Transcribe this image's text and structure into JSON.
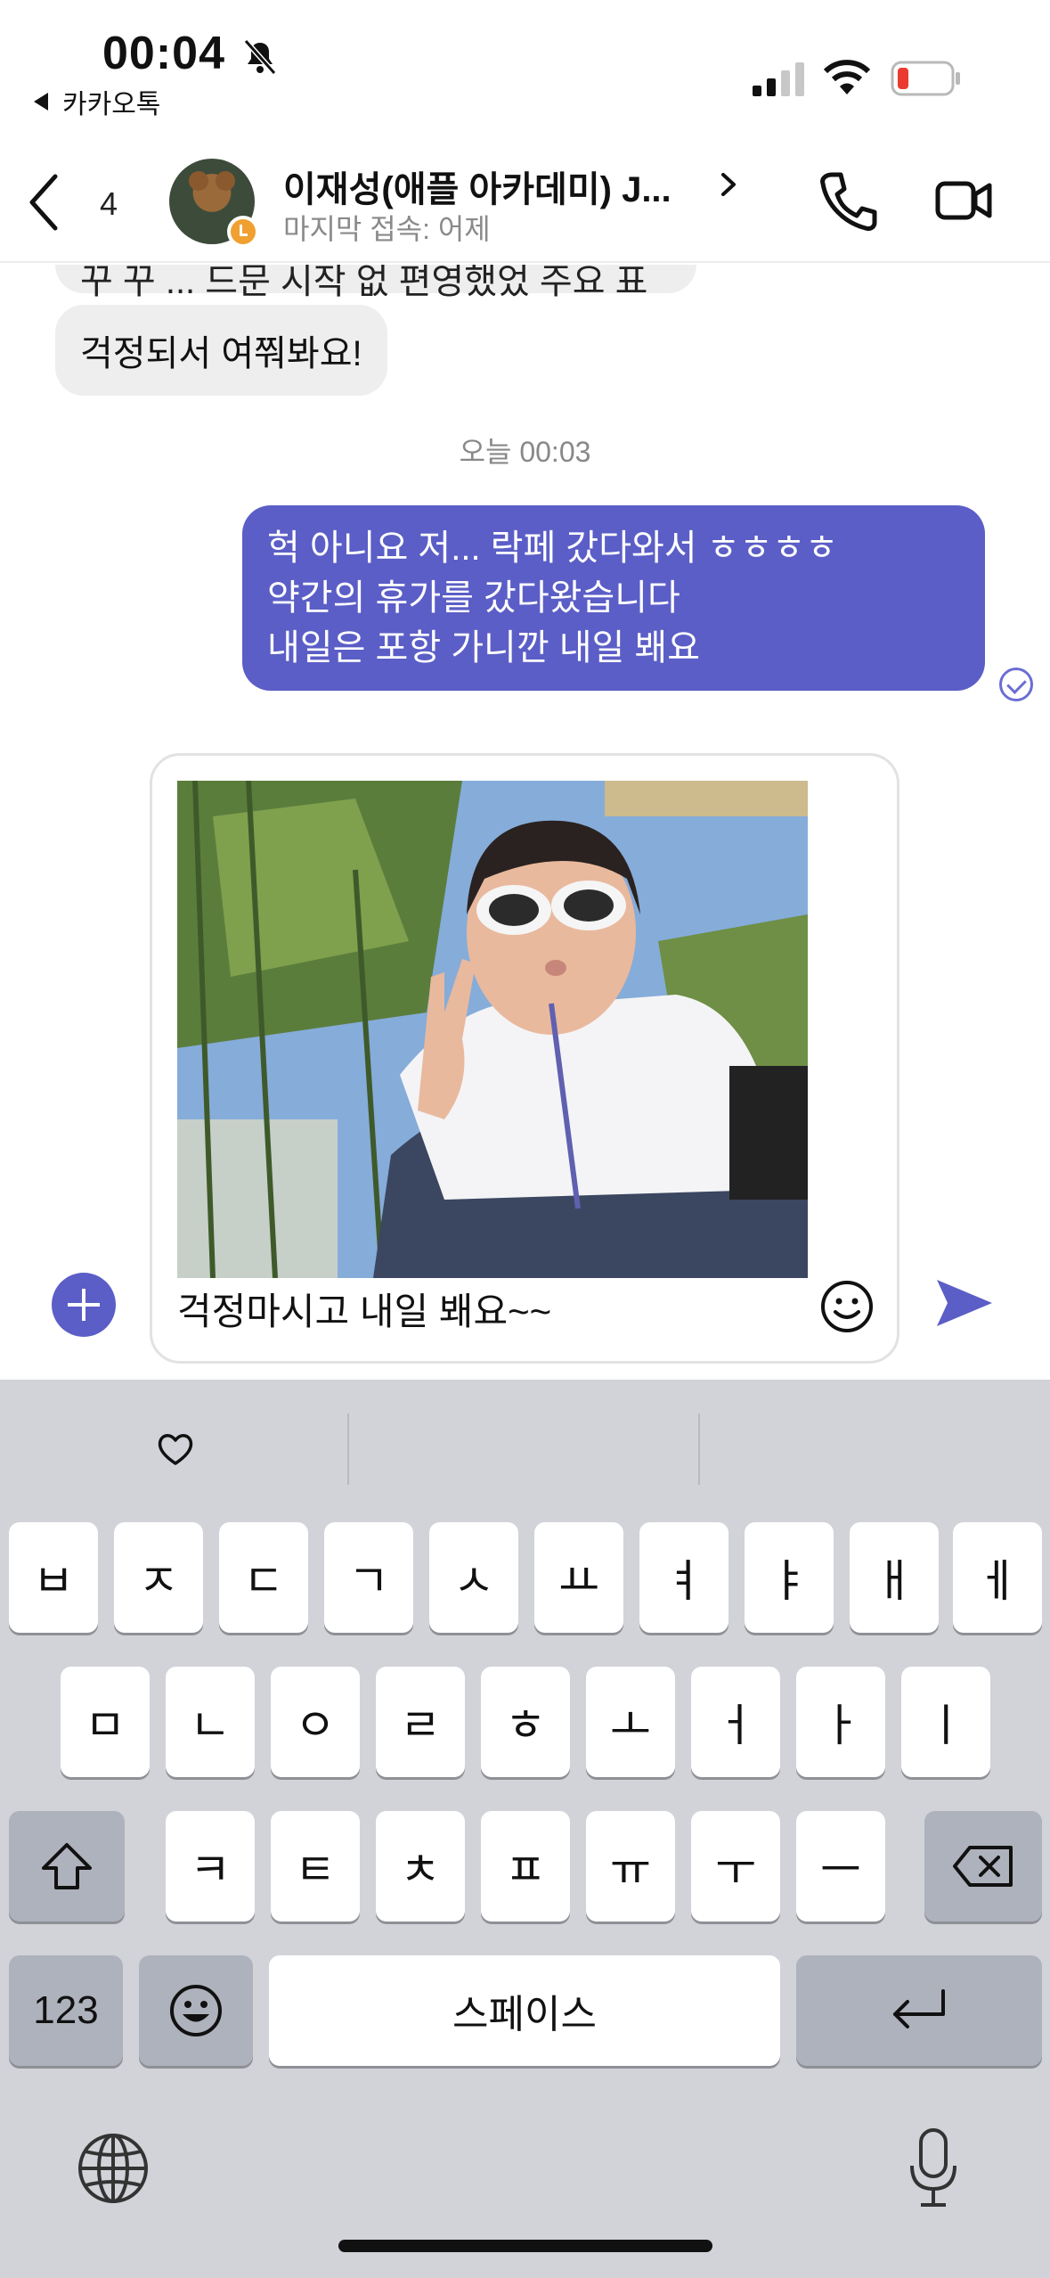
{
  "status_bar": {
    "time": "00:04",
    "back_app_label": "카카오톡"
  },
  "header": {
    "unread_count": "4",
    "name": "이재성(애플 아카데미) J...",
    "last_seen": "마지막 접속: 어제"
  },
  "messages": [
    {
      "direction": "in",
      "text": "꾸 꾸 ... 드문 시작 없 편영했었 주요 표"
    },
    {
      "direction": "in",
      "text": "걱정되서 여쭤봐요!"
    },
    {
      "type": "timestamp",
      "text": "오늘 00:03"
    },
    {
      "direction": "out",
      "lines": [
        "헉 아니요 저... 락페 갔다와서 ㅎㅎㅎㅎ",
        "약간의 휴가를 갔다왔습니다",
        "내일은 포항 가니깐 내일 봬요"
      ]
    }
  ],
  "composer": {
    "text": "걱정마시고 내일 봬요~~",
    "attachment": "photo"
  },
  "keyboard": {
    "row1": [
      "ㅂ",
      "ㅈ",
      "ㄷ",
      "ㄱ",
      "ㅅ",
      "ㅛ",
      "ㅕ",
      "ㅑ",
      "ㅐ",
      "ㅔ"
    ],
    "row2": [
      "ㅁ",
      "ㄴ",
      "ㅇ",
      "ㄹ",
      "ㅎ",
      "ㅗ",
      "ㅓ",
      "ㅏ",
      "ㅣ"
    ],
    "row3": [
      "ㅋ",
      "ㅌ",
      "ㅊ",
      "ㅍ",
      "ㅠ",
      "ㅜ",
      "ㅡ"
    ],
    "numbers_key": "123",
    "space_key": "스페이스"
  },
  "colors": {
    "accent": "#5b5ec6",
    "incoming_bubble": "#eeeeee",
    "keyboard_bg": "#d1d3d9"
  }
}
